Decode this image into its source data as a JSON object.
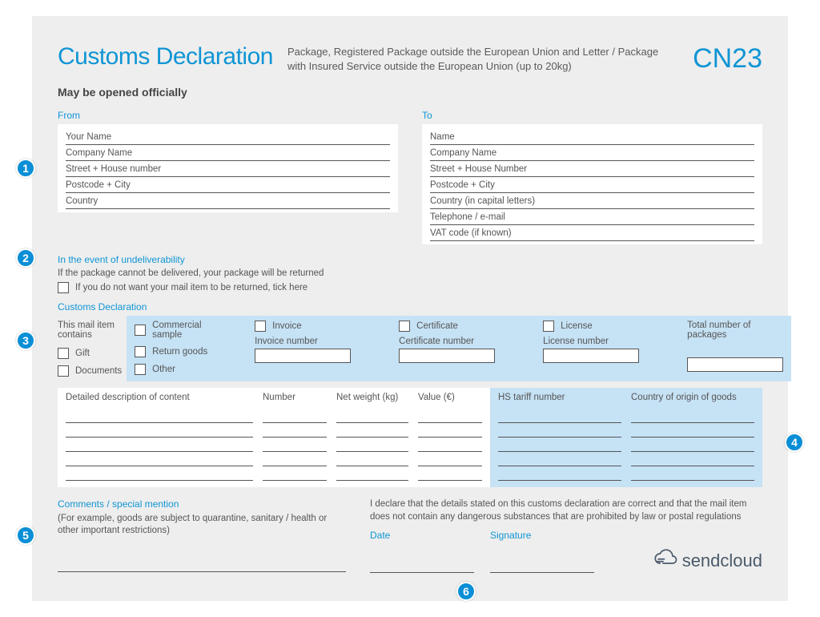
{
  "header": {
    "title": "Customs Declaration",
    "subtitle": "Package, Registered Package outside the European Union and Letter / Package with Insured Service outside the European Union (up to 20kg)",
    "code": "CN23",
    "open_note": "May be opened officially"
  },
  "from": {
    "label": "From",
    "lines": [
      "Your Name",
      "Company Name",
      "Street + House number",
      "Postcode + City",
      "Country"
    ]
  },
  "to": {
    "label": "To",
    "lines": [
      "Name",
      "Company Name",
      "Street + House Number",
      "Postcode + City",
      "Country (in capital letters)",
      "Telephone / e-mail",
      "VAT code (if known)"
    ]
  },
  "undeliv": {
    "label": "In the event of undeliverability",
    "note": "If the package cannot be delivered, your package will be returned",
    "tick": "If you do not want your mail item to be returned, tick here"
  },
  "decl": {
    "label": "Customs Declaration",
    "contains": "This mail item contains",
    "gift": "Gift",
    "documents": "Documents",
    "commercial": "Commercial sample",
    "return_goods": "Return goods",
    "other": "Other",
    "invoice": "Invoice",
    "invoice_no": "Invoice number",
    "certificate": "Certificate",
    "certificate_no": "Certificate number",
    "license": "License",
    "license_no": "License number",
    "total_packages": "Total number of packages"
  },
  "goods": {
    "desc": "Detailed description of content",
    "number": "Number",
    "weight": "Net weight (kg)",
    "value": "Value (€)",
    "hs": "HS tariff number",
    "origin": "Country of origin of goods"
  },
  "comments": {
    "label": "Comments / special mention",
    "hint": "(For example, goods are subject to quarantine, sanitary / health or other important restrictions)"
  },
  "declare": {
    "text": "I declare that the details stated on this customs declaration are correct and that the mail item does not contain any dangerous substances that are prohibited by law or postal regulations",
    "date": "Date",
    "signature": "Signature"
  },
  "logo": "sendcloud",
  "badges": {
    "b1": "1",
    "b2": "2",
    "b3": "3",
    "b4": "4",
    "b5": "5",
    "b6": "6"
  }
}
